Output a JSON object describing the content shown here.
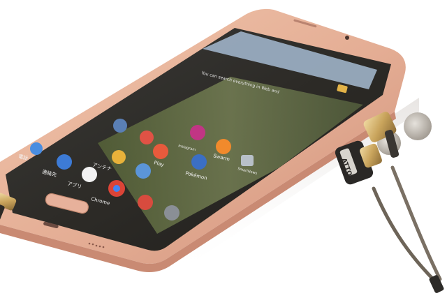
{
  "search_bar": {
    "hint": "You can search everything in Web and"
  },
  "app_labels": {
    "play": "Play",
    "instagram": "Instagram",
    "swarm": "Swarm",
    "smartnews": "SmartNews",
    "pokemon": "Pokémon",
    "contacts": "連絡先",
    "phone": "電話",
    "apps": "アプリ",
    "chrome": "Chrome",
    "antenna": "アンテナ"
  },
  "earphone_brand": "ATTO",
  "colors": {
    "phone_body": "#e8b8a0",
    "phone_edge": "#d89f88",
    "screen": "#2b2a26",
    "search_bar": "#9fb3c8",
    "earphone_metal": "#c9b27a",
    "cable": "#6d6458"
  }
}
